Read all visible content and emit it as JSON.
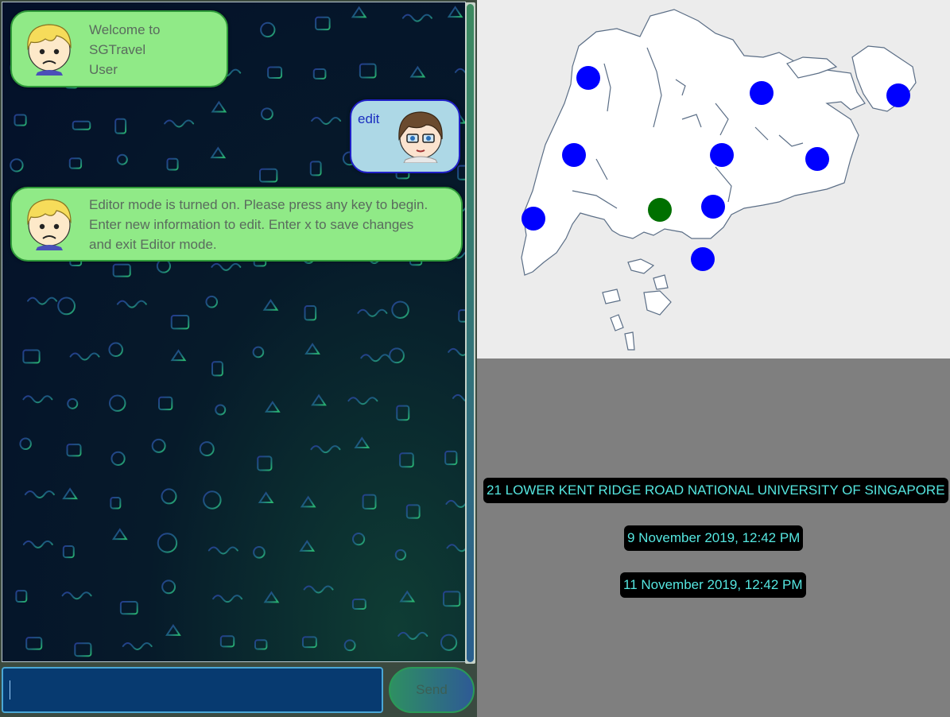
{
  "chat": {
    "messages": [
      {
        "sender": "bot",
        "text_lines": [
          "Welcome to",
          "SGTravel",
          "User"
        ],
        "avatar": "blonde-confused-avatar"
      },
      {
        "sender": "user",
        "text": "edit",
        "avatar": "brown-hair-glasses-avatar"
      },
      {
        "sender": "bot",
        "text_lines": [
          "Editor mode is turned on. Please press any key to begin.",
          "Enter new information to edit. Enter x to save changes",
          "and exit Editor mode."
        ],
        "avatar": "blonde-confused-avatar"
      }
    ],
    "input": {
      "value": "",
      "placeholder": ""
    },
    "send_label": "Send"
  },
  "map": {
    "markers": [
      {
        "name": "marker-1",
        "color": "#0000ff"
      },
      {
        "name": "marker-2",
        "color": "#0000ff"
      },
      {
        "name": "marker-3",
        "color": "#0000ff"
      },
      {
        "name": "marker-4",
        "color": "#0000ff"
      },
      {
        "name": "marker-5",
        "color": "#0000ff"
      },
      {
        "name": "marker-6",
        "color": "#0000ff"
      },
      {
        "name": "marker-7",
        "color": "#0000ff"
      },
      {
        "name": "marker-8",
        "color": "#0000ff"
      },
      {
        "name": "marker-9",
        "color": "#0000ff"
      },
      {
        "name": "marker-selected",
        "color": "#007000"
      }
    ]
  },
  "details": {
    "address": "21 LOWER KENT RIDGE ROAD NATIONAL UNIVERSITY OF SINGAPORE ...",
    "start_time": "9 November 2019, 12:42 PM",
    "end_time": "11 November 2019, 12:42 PM"
  },
  "colors": {
    "bot_bubble": "#90ea87",
    "user_bubble": "#add8e6",
    "marker_default": "#0000ff",
    "marker_selected": "#007000",
    "detail_text": "#55e6e0"
  }
}
